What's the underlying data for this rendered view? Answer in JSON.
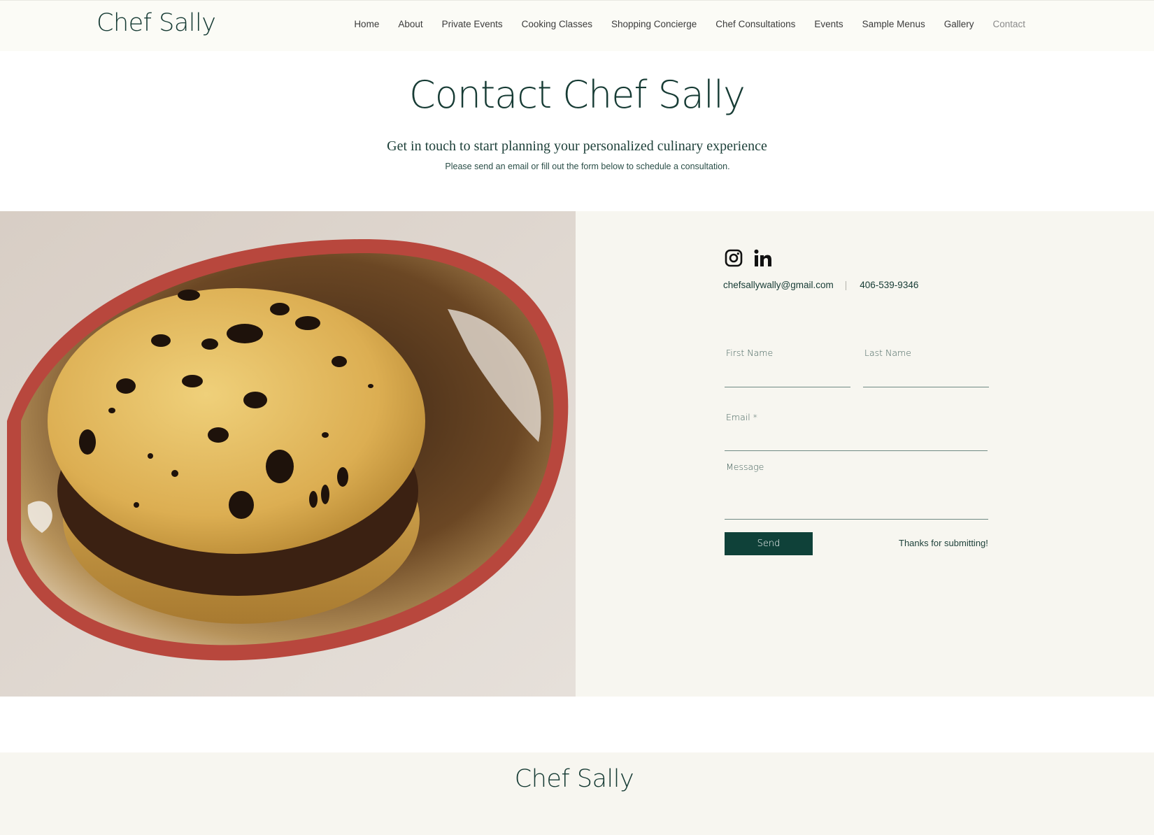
{
  "site": {
    "logo": "Chef Sally"
  },
  "nav": {
    "items": [
      {
        "label": "Home"
      },
      {
        "label": "About"
      },
      {
        "label": "Private Events"
      },
      {
        "label": "Cooking Classes"
      },
      {
        "label": "Shopping Concierge"
      },
      {
        "label": "Chef Consultations"
      },
      {
        "label": "Events"
      },
      {
        "label": "Sample Menus"
      },
      {
        "label": "Gallery"
      },
      {
        "label": "Contact"
      }
    ],
    "active": "Contact"
  },
  "hero": {
    "title": "Contact Chef Sally",
    "subtitle": "Get in touch to start planning your personalized culinary experience",
    "note": "Please send an email or fill out the form below to schedule a consultation."
  },
  "contact": {
    "socials": [
      {
        "icon": "instagram-icon"
      },
      {
        "icon": "linkedin-icon"
      }
    ],
    "email": "chefsallywally@gmail.com",
    "separator": "|",
    "phone": "406-539-9346"
  },
  "form": {
    "first_name_label": "First Name",
    "first_name_value": "",
    "last_name_label": "Last Name",
    "last_name_value": "",
    "email_label": "Email *",
    "email_value": "",
    "message_label": "Message",
    "message_value": "",
    "send_label": "Send",
    "confirmation": "Thanks for submitting!"
  },
  "footer": {
    "logo": "Chef Sally"
  },
  "colors": {
    "brand_green": "#0f4139",
    "text_green": "#163b34",
    "band_background": "#f7f6f0"
  }
}
